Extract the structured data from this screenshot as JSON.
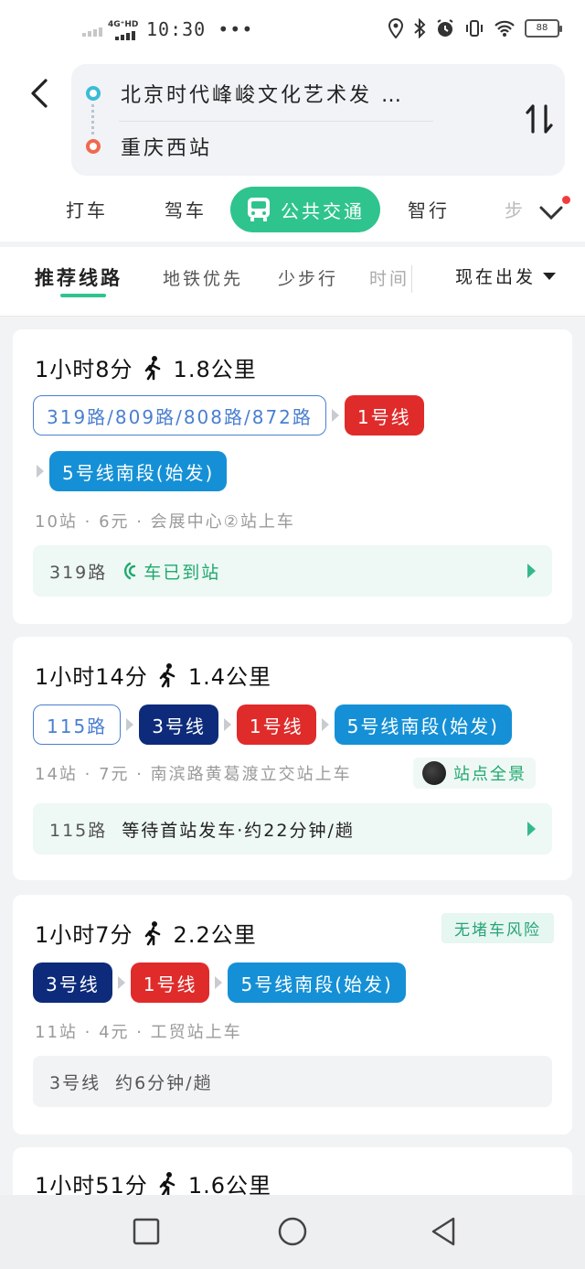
{
  "status_bar": {
    "network": "4G⁺HD",
    "time": "10:30",
    "dots": "•••",
    "battery": "88"
  },
  "route": {
    "from": "北京时代峰峻文化艺术发 …",
    "to": "重庆西站"
  },
  "modes": {
    "taxi": "打车",
    "drive": "驾车",
    "transit": "公共交通",
    "smart": "智行",
    "walk_partial": "步"
  },
  "filters": {
    "recommended": "推荐线路",
    "subway_first": "地铁优先",
    "less_walk": "少步行",
    "time_partial": "时间",
    "depart": "现在出发"
  },
  "routes": [
    {
      "duration": "1小时8分",
      "walk": "1.8公里",
      "badges": [
        "319路/809路/808路/872路",
        "1号线",
        "5号线南段(始发)"
      ],
      "meta": "10站 · 6元 · 会展中心②站上车",
      "status_route": "319路",
      "status_text": "车已到站"
    },
    {
      "duration": "1小时14分",
      "walk": "1.4公里",
      "badges": [
        "115路",
        "3号线",
        "1号线",
        "5号线南段(始发)"
      ],
      "meta": "14站 · 7元 · 南滨路黄葛渡立交站上车",
      "panorama": "站点全景",
      "status_route": "115路",
      "status_text": "等待首站发车·约22分钟/趟"
    },
    {
      "duration": "1小时7分",
      "walk": "2.2公里",
      "tag": "无堵车风险",
      "badges": [
        "3号线",
        "1号线",
        "5号线南段(始发)"
      ],
      "meta": "11站 · 4元 · 工贸站上车",
      "status_route": "3号线",
      "status_text": "约6分钟/趟"
    },
    {
      "duration": "1小时51分",
      "walk": "1.6公里"
    }
  ],
  "colors": {
    "accent_green": "#2fc48d",
    "line1_red": "#e02b2b",
    "line3_navy": "#0d2b7a",
    "line5_blue": "#1590d6",
    "bus_outline": "#4a7fd0"
  }
}
